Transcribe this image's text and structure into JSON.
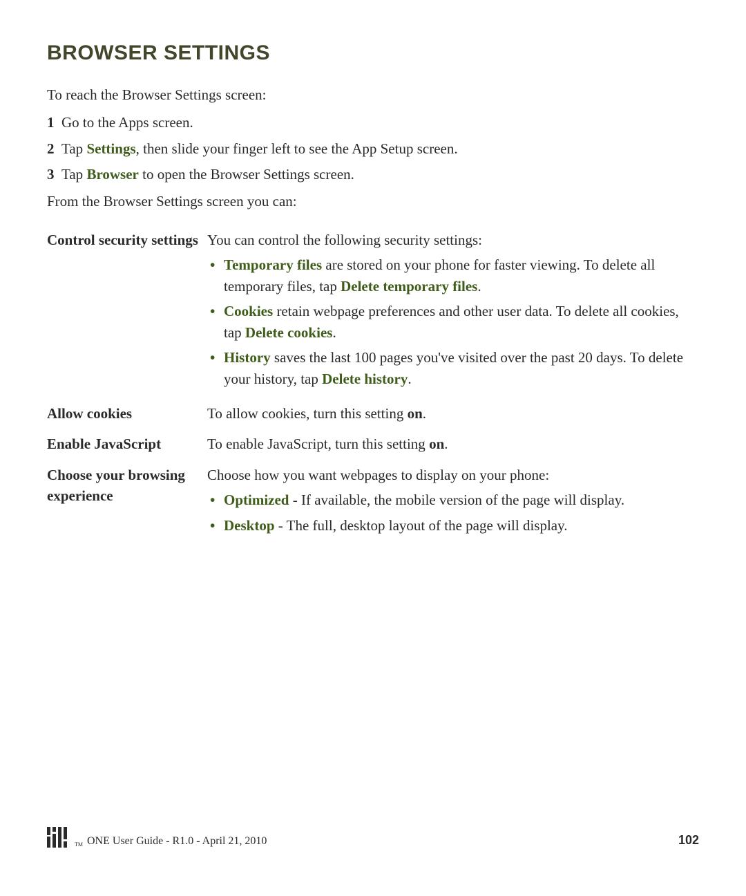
{
  "title": "BROWSER SETTINGS",
  "intro": "To reach the Browser Settings screen:",
  "steps": {
    "s1": {
      "num": "1",
      "text_a": "Go to the Apps screen."
    },
    "s2": {
      "num": "2",
      "text_a": "Tap ",
      "link": "Settings",
      "text_b": ", then slide your finger left to see the App Setup screen."
    },
    "s3": {
      "num": "3",
      "text_a": "Tap ",
      "link": "Browser",
      "text_b": " to open the Browser Settings screen."
    }
  },
  "from_line": "From the Browser Settings screen you can:",
  "settings": {
    "security": {
      "label": "Control security settings",
      "lead": "You can control the following security settings:",
      "items": {
        "temp": {
          "term": "Temporary files",
          "rest_a": " are stored on your phone for faster viewing. To delete all temporary files, tap ",
          "action": "Delete temporary files",
          "rest_b": "."
        },
        "cookies": {
          "term": "Cookies",
          "rest_a": " retain webpage preferences and other user data. To delete all cookies, tap ",
          "action": "Delete cookies",
          "rest_b": "."
        },
        "history": {
          "term": "History",
          "rest_a": " saves the last 100 pages you've visited over the past 20 days. To delete your history, tap ",
          "action": "Delete history",
          "rest_b": "."
        }
      }
    },
    "allow_cookies": {
      "label": "Allow cookies",
      "text_a": "To allow cookies, turn this setting ",
      "bold": "on",
      "text_b": "."
    },
    "enable_js": {
      "label": "Enable JavaScript",
      "text_a": "To enable JavaScript, turn this setting ",
      "bold": "on",
      "text_b": "."
    },
    "browsing": {
      "label": "Choose your browsing experience",
      "lead": "Choose how you want webpages to display on your phone:",
      "items": {
        "opt": {
          "term": "Optimized",
          "rest": " - If available, the mobile version of the page will display."
        },
        "desk": {
          "term": "Desktop",
          "rest": " - The full, desktop layout of the page will display."
        }
      }
    }
  },
  "footer": {
    "tm": "TM",
    "text": "ONE User Guide - R1.0 - April 21, 2010",
    "page": "102"
  }
}
